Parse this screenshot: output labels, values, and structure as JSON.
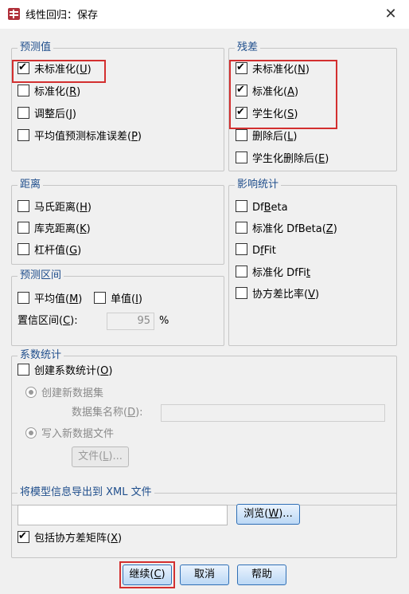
{
  "window": {
    "title": "线性回归：保存",
    "close_glyph": "✕"
  },
  "predicted": {
    "legend": "预测值",
    "items": [
      {
        "text": "未标准化(",
        "key": "U",
        "end": ")",
        "checked": true
      },
      {
        "text": "标准化(",
        "key": "R",
        "end": ")",
        "checked": false
      },
      {
        "text": "调整后(",
        "key": "J",
        "end": ")",
        "checked": false
      },
      {
        "text": "平均值预测标准误差(",
        "key": "P",
        "end": ")",
        "checked": false
      }
    ]
  },
  "residuals": {
    "legend": "残差",
    "items": [
      {
        "text": "未标准化(",
        "key": "N",
        "end": ")",
        "checked": true
      },
      {
        "text": "标准化(",
        "key": "A",
        "end": ")",
        "checked": true
      },
      {
        "text": "学生化(",
        "key": "S",
        "end": ")",
        "checked": true
      },
      {
        "text": "删除后(",
        "key": "L",
        "end": ")",
        "checked": false
      },
      {
        "text": "学生化删除后(",
        "key": "E",
        "end": ")",
        "checked": false
      }
    ]
  },
  "distances": {
    "legend": "距离",
    "items": [
      {
        "text": "马氏距离(",
        "key": "H",
        "end": ")",
        "checked": false
      },
      {
        "text": "库克距离(",
        "key": "K",
        "end": ")",
        "checked": false
      },
      {
        "text": "杠杆值(",
        "key": "G",
        "end": ")",
        "checked": false
      }
    ]
  },
  "influence": {
    "legend": "影响统计",
    "items": [
      {
        "text": "Df",
        "key": "B",
        "end": "eta",
        "checked": false
      },
      {
        "text": "标准化 DfBeta(",
        "key": "Z",
        "end": ")",
        "checked": false
      },
      {
        "text": "D",
        "key": "f",
        "end": "Fit",
        "checked": false
      },
      {
        "text": "标准化 DfFi",
        "key": "t",
        "end": "",
        "checked": false
      },
      {
        "text": "协方差比率(",
        "key": "V",
        "end": ")",
        "checked": false
      }
    ]
  },
  "prediction_intervals": {
    "legend": "预测区间",
    "mean": {
      "text": "平均值(",
      "key": "M",
      "end": ")",
      "checked": false
    },
    "individual": {
      "text": "单值(",
      "key": "I",
      "end": ")",
      "checked": false
    },
    "ci_label": {
      "text": "置信区间(",
      "key": "C",
      "end": "):"
    },
    "ci_value": "95",
    "ci_unit": "%"
  },
  "coefficients": {
    "legend": "系数统计",
    "create": {
      "text": "创建系数统计(",
      "key": "O",
      "end": ")",
      "checked": false
    },
    "new_dataset": "创建新数据集",
    "dataset_name_label": {
      "text": "数据集名称(",
      "key": "D",
      "end": "):"
    },
    "dataset_name_value": "",
    "write_file": "写入新数据文件",
    "file_button": {
      "text": "文件(",
      "key": "L",
      "end": ")..."
    }
  },
  "export": {
    "legend": "将模型信息导出到 XML 文件",
    "path_value": "",
    "browse_button": {
      "text": "浏览(",
      "key": "W",
      "end": ")..."
    },
    "include_cov": {
      "text": "包括协方差矩阵(",
      "key": "X",
      "end": ")",
      "checked": true
    }
  },
  "footer": {
    "continue": {
      "text": "继续(",
      "key": "C",
      "end": ")"
    },
    "cancel": "取消",
    "help": "帮助"
  }
}
